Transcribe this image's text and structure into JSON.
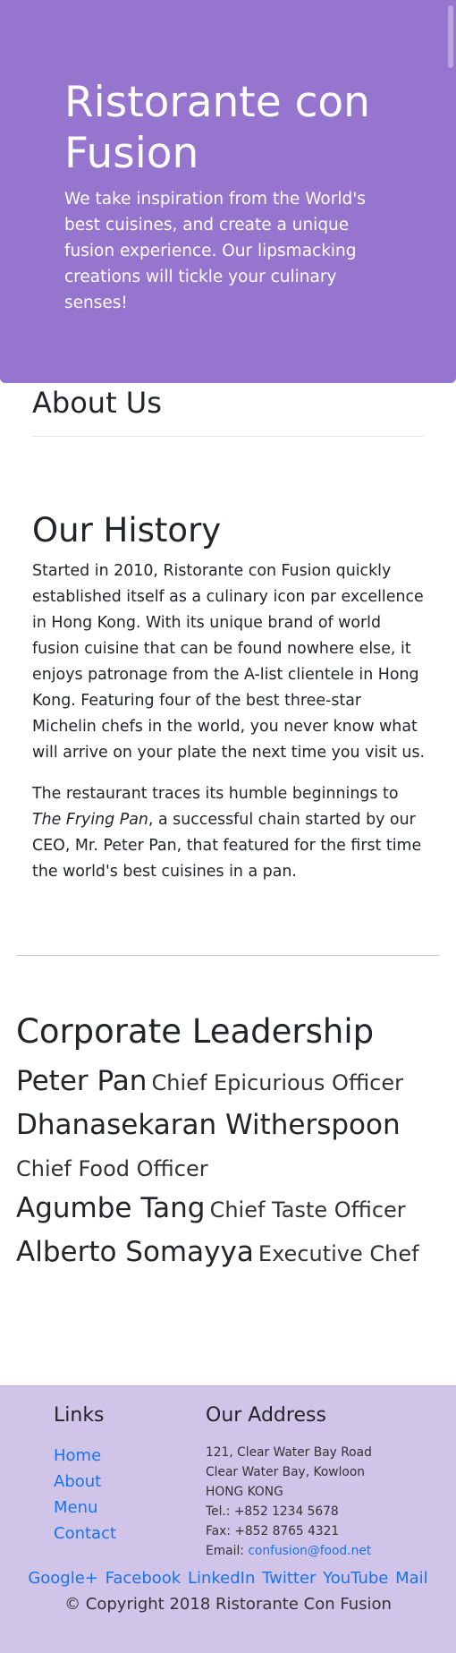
{
  "jumbotron": {
    "title": "Ristorante con Fusion",
    "description": "We take inspiration from the World's best cuisines, and create a unique fusion experience. Our lipsmacking creations will tickle your culinary senses!"
  },
  "about": {
    "title": "About Us"
  },
  "history": {
    "title": "Our History",
    "paragraph1": "Started in 2010, Ristorante con Fusion quickly established itself as a culinary icon par excellence in Hong Kong. With its unique brand of world fusion cuisine that can be found nowhere else, it enjoys patronage from the A-list clientele in Hong Kong. Featuring four of the best three-star Michelin chefs in the world, you never know what will arrive on your plate the next time you visit us.",
    "paragraph2_before": "The restaurant traces its humble beginnings to ",
    "paragraph2_italic": "The Frying Pan",
    "paragraph2_after": ", a successful chain started by our CEO, Mr. Peter Pan, that featured for the first time the world's best cuisines in a pan."
  },
  "leadership": {
    "title": "Corporate Leadership",
    "leaders": [
      {
        "name": "Peter Pan",
        "designation": "Chief Epicurious Officer"
      },
      {
        "name": "Dhanasekaran Witherspoon",
        "designation": "Chief Food Officer"
      },
      {
        "name": "Agumbe Tang",
        "designation": "Chief Taste Officer"
      },
      {
        "name": "Alberto Somayya",
        "designation": "Executive Chef"
      }
    ]
  },
  "footer": {
    "links_heading": "Links",
    "links": [
      "Home",
      "About",
      "Menu",
      "Contact"
    ],
    "address_heading": "Our Address",
    "address_line1": "121, Clear Water Bay Road",
    "address_line2": "Clear Water Bay, Kowloon",
    "address_line3": "HONG KONG",
    "tel": "Tel.: +852 1234 5678",
    "fax": "Fax: +852 8765 4321",
    "email_label": "Email: ",
    "email": "confusion@food.net",
    "social": [
      "Google+",
      "Facebook",
      "LinkedIn",
      "Twitter",
      "YouTube",
      "Mail"
    ],
    "copyright": "© Copyright 2018 Ristorante Con Fusion"
  },
  "colors": {
    "jumbotron_bg": "#9575cd",
    "footer_bg": "#d1c4e9",
    "link": "#1a73e8"
  }
}
